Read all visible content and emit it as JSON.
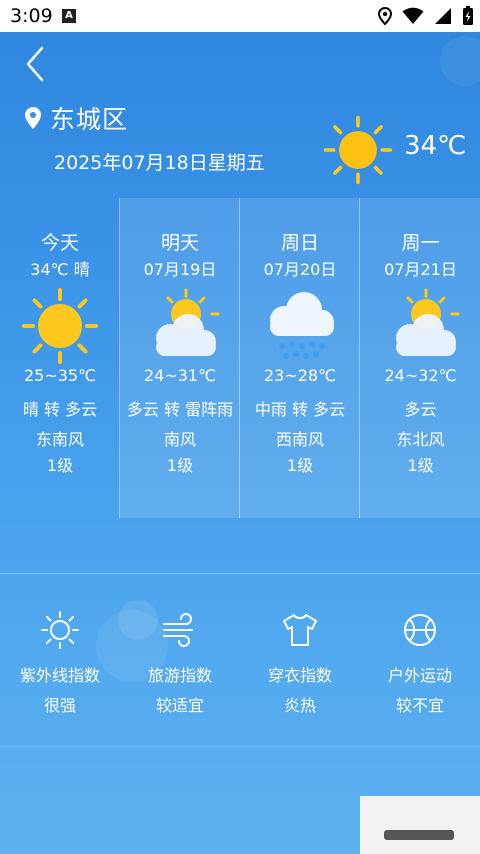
{
  "status": {
    "time": "3:09",
    "notif_icon": "A"
  },
  "header": {
    "location": "东城区",
    "date": "2025年07月18日星期五",
    "current_temp": "34℃",
    "current_icon": "sun-icon"
  },
  "forecast": [
    {
      "title": "今天",
      "sub": "34℃ 晴",
      "icon": "sun-icon",
      "range": "25~35℃",
      "cond": "晴 转 多云",
      "wind": "东南风",
      "level": "1级"
    },
    {
      "title": "明天",
      "sub": "07月19日",
      "icon": "partly-cloudy-icon",
      "range": "24~31℃",
      "cond": "多云 转 雷阵雨",
      "wind": "南风",
      "level": "1级"
    },
    {
      "title": "周日",
      "sub": "07月20日",
      "icon": "rain-icon",
      "range": "23~28℃",
      "cond": "中雨 转 多云",
      "wind": "西南风",
      "level": "1级"
    },
    {
      "title": "周一",
      "sub": "07月21日",
      "icon": "partly-cloudy-icon",
      "range": "24~32℃",
      "cond": "多云",
      "wind": "东北风",
      "level": "1级"
    }
  ],
  "indices": [
    {
      "label": "紫外线指数",
      "value": "很强",
      "icon": "uv-sun-icon"
    },
    {
      "label": "旅游指数",
      "value": "较适宜",
      "icon": "wind-icon"
    },
    {
      "label": "穿衣指数",
      "value": "炎热",
      "icon": "shirt-icon"
    },
    {
      "label": "户外运动",
      "value": "较不宜",
      "icon": "ball-icon"
    }
  ],
  "colors": {
    "sun": "#ffc81e",
    "sun_core": "#ffb400",
    "cloud": "#eef6ff",
    "rain": "#3aa0f5"
  }
}
